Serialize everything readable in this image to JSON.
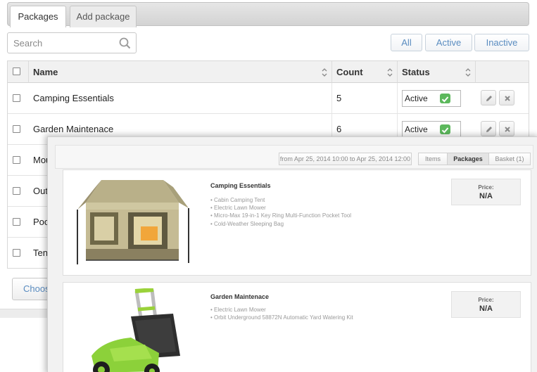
{
  "tabs": [
    {
      "label": "Packages",
      "active": true
    },
    {
      "label": "Add package",
      "active": false
    }
  ],
  "search": {
    "placeholder": "Search",
    "icon": "search-icon"
  },
  "filters": {
    "all": "All",
    "active": "Active",
    "inactive": "Inactive",
    "color": "#5a8cc0"
  },
  "table": {
    "columns": {
      "name": "Name",
      "count": "Count",
      "status": "Status"
    },
    "rows": [
      {
        "name": "Camping Essentials",
        "count": "5",
        "status": "Active"
      },
      {
        "name": "Garden Maintenace",
        "count": "6",
        "status": "Active"
      },
      {
        "name": "Mou",
        "count": "",
        "status": ""
      },
      {
        "name": "Out",
        "count": "",
        "status": ""
      },
      {
        "name": "Poo",
        "count": "",
        "status": ""
      },
      {
        "name": "Ten",
        "count": "",
        "status": ""
      }
    ],
    "status_color": "#5cb85c"
  },
  "footer": {
    "choose_label": "Choos"
  },
  "overlay": {
    "date_range": "from Apr 25, 2014 10:00 to Apr 25, 2014 12:00",
    "segments": [
      {
        "label": "Items",
        "active": false
      },
      {
        "label": "Packages",
        "active": true
      },
      {
        "label": "Basket (1)",
        "active": false
      }
    ],
    "cards": [
      {
        "title": "Camping Essentials",
        "items": [
          "Cabin Camping Tent",
          "Electric Lawn Mower",
          "Micro-Max 19-in-1 Key Ring Multi-Function Pocket Tool",
          "Cold-Weather Sleeping Bag"
        ],
        "price_label": "Price:",
        "price_value": "N/A",
        "image": "camping-tent-image"
      },
      {
        "title": "Garden Maintenace",
        "items": [
          "Electric Lawn Mower",
          "Orbit Underground 58872N Automatic Yard Watering Kit"
        ],
        "price_label": "Price:",
        "price_value": "N/A",
        "image": "lawn-mower-image"
      }
    ]
  }
}
